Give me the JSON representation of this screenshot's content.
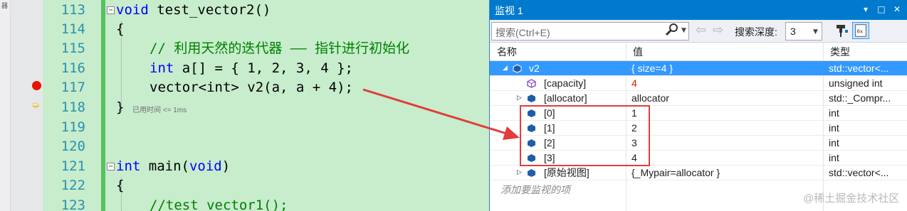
{
  "editor": {
    "side_tab_label": "器",
    "line_numbers": [
      "113",
      "114",
      "115",
      "116",
      "117",
      "118",
      "119",
      "120",
      "121",
      "122",
      "123"
    ],
    "lines": {
      "l113_kw": "void",
      "l113_rest": " test_vector2()",
      "l114": "{",
      "l115_comment": "// 利用天然的迭代器 —— 指针进行初始化",
      "l116_kw": "int",
      "l116_rest": " a[] = { 1, 2, 3, 4 };",
      "l117": "vector<int> v2(a, a + 4);",
      "l118": "}",
      "l121_kw": "int",
      "l121_mid": " main(",
      "l121_kw2": "void",
      "l121_end": ")",
      "l122": "{",
      "l123": "//test_vector1();"
    },
    "fold_collapse": "−",
    "perf_tip": "已用时间 <= 1ms",
    "breakpoint_color": "#e51400",
    "current_line_icon": "execution-arrow"
  },
  "watch": {
    "title": "监视 1",
    "title_dropdown": "▾",
    "title_maximize": "□",
    "title_close": "✕",
    "search_placeholder": "搜索(Ctrl+E)",
    "search_depth_label": "搜索深度:",
    "search_depth_value": "3",
    "columns": {
      "name": "名称",
      "value": "值",
      "type": "类型"
    },
    "rows": [
      {
        "name": "v2",
        "value": "{ size=4 }",
        "type": "std::vector<...",
        "expander": "◢",
        "icon": "object"
      },
      {
        "name": "[capacity]",
        "value": "4",
        "type": "unsigned int",
        "expander": "",
        "icon": "property"
      },
      {
        "name": "[allocator]",
        "value": "allocator",
        "type": "std::_Compr...",
        "expander": "▷",
        "icon": "object"
      },
      {
        "name": "[0]",
        "value": "1",
        "type": "int",
        "expander": "",
        "icon": "object"
      },
      {
        "name": "[1]",
        "value": "2",
        "type": "int",
        "expander": "",
        "icon": "object"
      },
      {
        "name": "[2]",
        "value": "3",
        "type": "int",
        "expander": "",
        "icon": "object"
      },
      {
        "name": "[3]",
        "value": "4",
        "type": "int",
        "expander": "",
        "icon": "object"
      },
      {
        "name": "[原始视图]",
        "value": "{_Mypair=allocator }",
        "type": "std::vector<...",
        "expander": "▷",
        "icon": "object"
      }
    ],
    "add_watch_hint": "添加要监视的项",
    "accent_color": "#007acc",
    "changed_value_color": "#e51400"
  },
  "annotation": {
    "color": "#e23c3c"
  },
  "watermark": "@稀土掘金技术社区"
}
